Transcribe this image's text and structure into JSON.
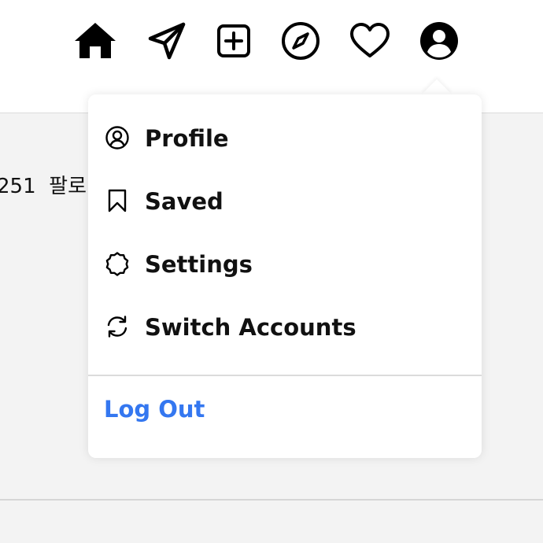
{
  "nav": {
    "icons": [
      "home-icon",
      "direct-message-icon",
      "new-post-icon",
      "explore-icon",
      "activity-icon",
      "profile-avatar-icon"
    ]
  },
  "profile_stats": {
    "text": "251  팔로"
  },
  "account_menu": {
    "items": [
      {
        "label": "Profile",
        "icon": "profile-icon"
      },
      {
        "label": "Saved",
        "icon": "bookmark-icon"
      },
      {
        "label": "Settings",
        "icon": "settings-icon"
      },
      {
        "label": "Switch Accounts",
        "icon": "switch-accounts-icon"
      }
    ],
    "logout_label": "Log Out",
    "logout_color": "#3477f0"
  }
}
